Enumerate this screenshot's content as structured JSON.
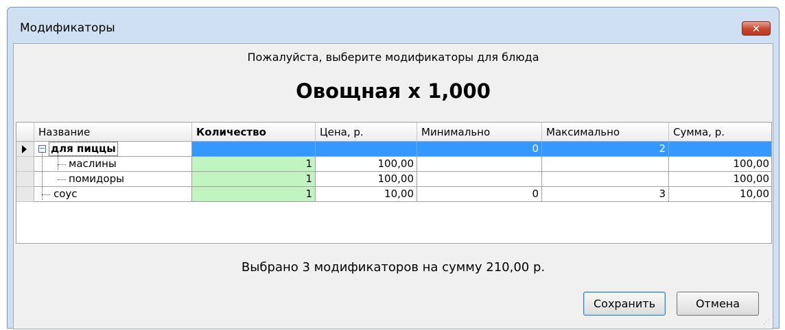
{
  "window": {
    "title": "Модификаторы",
    "close_glyph": "✕"
  },
  "subtitle": "Пожалуйста, выберите модификаторы для блюда",
  "dish": "Овощная x 1,000",
  "grid": {
    "columns": [
      "Название",
      "Количество",
      "Цена, р.",
      "Минимально",
      "Максимально",
      "Сумма, р."
    ],
    "rows": [
      {
        "name": "для пиццы",
        "qty": "",
        "price": "",
        "min": "0",
        "max": "2",
        "sum": ""
      },
      {
        "name": "маслины",
        "qty": "1",
        "price": "100,00",
        "min": "",
        "max": "",
        "sum": "100,00"
      },
      {
        "name": "помидоры",
        "qty": "1",
        "price": "100,00",
        "min": "",
        "max": "",
        "sum": "100,00"
      },
      {
        "name": "соус",
        "qty": "1",
        "price": "10,00",
        "min": "0",
        "max": "3",
        "sum": "10,00"
      }
    ]
  },
  "summary": "Выбрано 3 модификаторов на сумму 210,00 р.",
  "buttons": {
    "save": "Сохранить",
    "cancel": "Отмена"
  },
  "colors": {
    "selected_row": "#3399ff",
    "quantity_cell": "#c2f4c2",
    "close_button": "#c8462c"
  },
  "icons": [
    "close-icon",
    "row-pointer-icon",
    "collapse-icon",
    "resize-grip-icon"
  ]
}
